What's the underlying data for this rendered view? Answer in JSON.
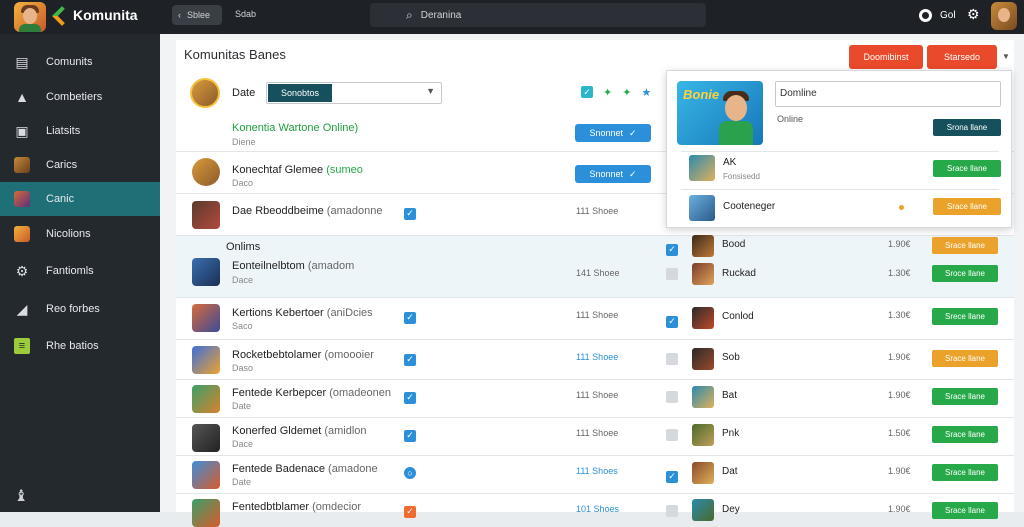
{
  "topbar": {
    "brand": "Komunita",
    "back_label": "Sblee",
    "home_label": "Sdab",
    "search_placeholder": "Deranina",
    "user_label": "Gol",
    "colors": {
      "bar": "#1e2125",
      "accent_green": "#43b649",
      "accent_orange": "#f39a1b"
    }
  },
  "sidebar": {
    "items": [
      {
        "label": "Comunits",
        "icon": "storefront-icon",
        "active": false
      },
      {
        "label": "Combetiers",
        "icon": "person-icon",
        "active": false
      },
      {
        "label": "Liatsits",
        "icon": "calendar-icon",
        "active": false
      },
      {
        "label": "Carics",
        "icon": "game-art-icon",
        "active": false
      },
      {
        "label": "Canic",
        "icon": "game-art-icon",
        "active": true
      },
      {
        "label": "Nicolions",
        "icon": "game-art-icon",
        "active": false
      },
      {
        "label": "Fantiomls",
        "icon": "gear-icon",
        "active": false
      },
      {
        "label": "Reo forbes",
        "icon": "chart-icon",
        "active": false
      },
      {
        "label": "Rhe batios",
        "icon": "list-icon",
        "active": false
      }
    ],
    "colors": {
      "bg": "#24292e",
      "active": "#1f6f76"
    }
  },
  "panel": {
    "title": "Komunitas Banes",
    "primary_button": "Doomibinst",
    "secondary_button": "Starsedo",
    "filter": {
      "label": "Date",
      "selected": "Sonobtos"
    },
    "online_section": {
      "title": "Konentia Wartone Online)",
      "meta": "Diene"
    },
    "online_group_label": "Onlims",
    "pill_label": "Snonnet"
  },
  "rows": [
    {
      "title": "Konechtaf Glemee",
      "sub": "(sumeo",
      "meta": "Daco",
      "type": "pill",
      "thumb": "game-art-icon"
    },
    {
      "title": "Dae Rbeoddbeime",
      "sub": "(amadonne",
      "meta": "",
      "check": "blue",
      "info": "111 Shoee",
      "info_blue": false
    },
    {
      "title": "Eonteilnelbtom",
      "sub": "(amadom",
      "meta": "Dace",
      "check": "none",
      "info": "141 Shoee",
      "info_blue": false,
      "check2": "grey",
      "name": "Ruckad",
      "price": "1.30€",
      "btn": "Sroce llane",
      "btn_color": "green",
      "shaded": true
    },
    {
      "title": "Kertions Kebertoer",
      "sub": "(aniDcies",
      "meta": "Saco",
      "check": "blue",
      "info": "111 Shoee",
      "info_blue": false,
      "check2": "blue",
      "name": "Conlod",
      "price": "1.30€",
      "btn": "Srece llane",
      "btn_color": "green"
    },
    {
      "title": "Rocketbebtolamer",
      "sub": "(omoooier",
      "meta": "Daso",
      "check": "blue",
      "info": "111 Shoee",
      "info_blue": true,
      "check2": "grey",
      "name": "Sob",
      "price": "1.90€",
      "btn": "Srace llane",
      "btn_color": "orange"
    },
    {
      "title": "Fentede Kerbepcer",
      "sub": "(omadeonen",
      "meta": "Date",
      "check": "blue",
      "info": "111 Shoee",
      "info_blue": false,
      "check2": "grey",
      "name": "Bat",
      "price": "1.90€",
      "btn": "Srace llane",
      "btn_color": "green"
    },
    {
      "title": "Konerfed Gldemet",
      "sub": "(amidlon",
      "meta": "Dace",
      "check": "blue",
      "info": "111 Shoee",
      "info_blue": false,
      "check2": "grey",
      "name": "Pnk",
      "price": "1.50€",
      "btn": "Srace llane",
      "btn_color": "green"
    },
    {
      "title": "Fentede Badenace",
      "sub": "(amadone",
      "meta": "Date",
      "check": "blue-ring",
      "info": "111 Shoes",
      "info_blue": true,
      "check2": "blue",
      "name": "Dat",
      "price": "1.90€",
      "btn": "Srace llane",
      "btn_color": "green"
    },
    {
      "title": "Fentedbtblamer",
      "sub": "(omdecior",
      "meta": "",
      "check": "orange",
      "info": "101 Shoes",
      "info_blue": true,
      "check2": "grey",
      "name": "Dey",
      "price": "1.90€",
      "btn": "Srace llane",
      "btn_color": "green"
    }
  ],
  "popup": {
    "game_logo": "Bonie",
    "input_value": "Domline",
    "status": "Online",
    "primary_button": "Srona llane",
    "side_row": {
      "check2": "blue",
      "name": "Bood",
      "price": "1.90€",
      "btn": "Srace llane",
      "btn_color": "orange"
    },
    "items": [
      {
        "name": "AK",
        "meta": "Fonsisedd",
        "btn": "Srace llane",
        "btn_color": "green"
      },
      {
        "name": "Cooteneger",
        "meta": "",
        "btn": "Srace llane",
        "btn_color": "orange"
      }
    ]
  },
  "colors": {
    "red": "#e94a2b",
    "green": "#27a94a",
    "orange": "#eba22a",
    "blue": "#2b90d9",
    "teal": "#16505d"
  }
}
